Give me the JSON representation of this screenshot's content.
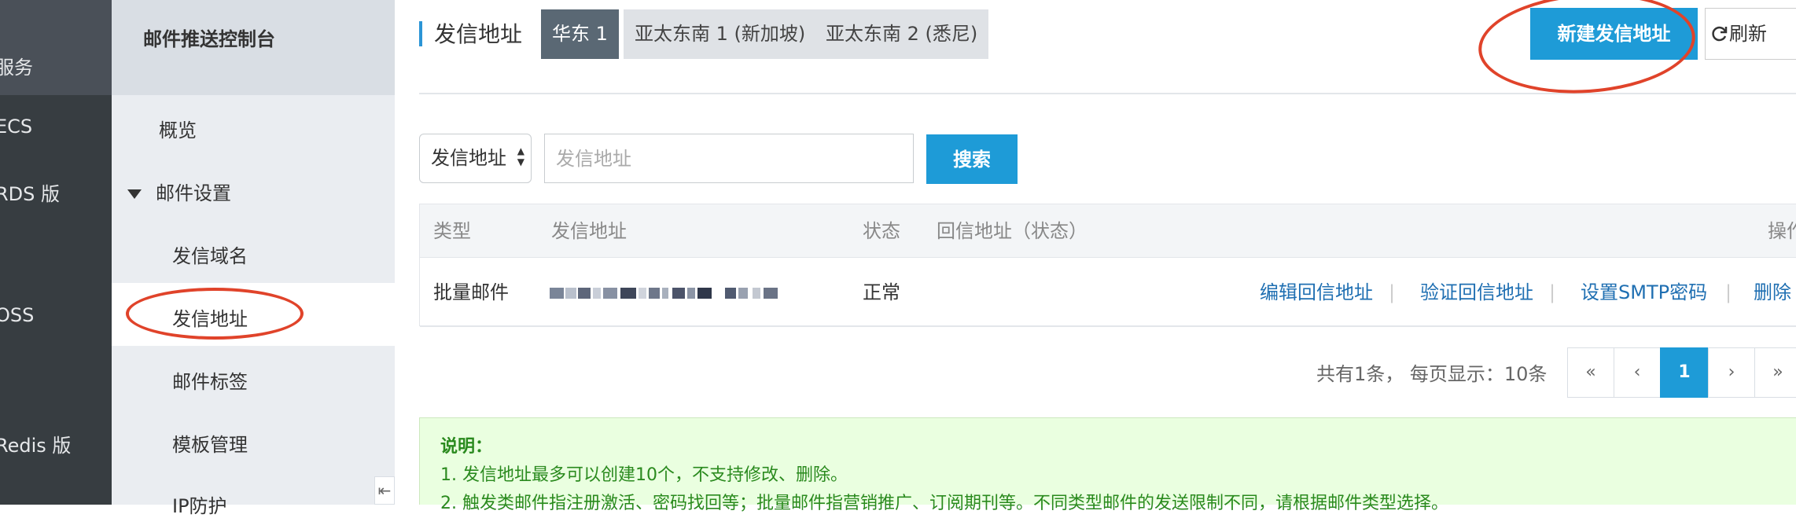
{
  "nav": {
    "items": [
      "服务",
      "ECS",
      "RDS 版",
      "OSS",
      "Redis 版"
    ]
  },
  "sidebar": {
    "title": "邮件推送控制台",
    "overview": "概览",
    "group": "邮件设置",
    "items": [
      "发信域名",
      "发信地址",
      "邮件标签",
      "模板管理",
      "IP防护"
    ],
    "collapse_icon": "⇤"
  },
  "header": {
    "title": "发信地址",
    "regions": [
      "华东 1",
      "亚太东南 1 (新加坡)",
      "亚太东南 2 (悉尼)"
    ],
    "active_region": "华东 1",
    "new_button": "新建发信地址",
    "refresh_button": "刷新"
  },
  "search": {
    "field_select": "发信地址",
    "placeholder": "发信地址",
    "button": "搜索"
  },
  "table": {
    "columns": [
      "类型",
      "发信地址",
      "状态",
      "回信地址（状态）",
      "操作"
    ],
    "rows": [
      {
        "type": "批量邮件",
        "address": "",
        "status": "正常",
        "reply": "",
        "actions": [
          "编辑回信地址",
          "验证回信地址",
          "设置SMTP密码",
          "删除"
        ]
      }
    ]
  },
  "pagination": {
    "summary": "共有1条， 每页显示：10条",
    "first": "«",
    "prev": "‹",
    "current": "1",
    "next": "›",
    "last": "»"
  },
  "note": {
    "heading": "说明：",
    "lines": [
      "1. 发信地址最多可以创建10个，不支持修改、删除。",
      "2. 触发类邮件指注册激活、密码找回等；批量邮件指营销推广、订阅期刊等。不同类型邮件的发送限制不同，请根据邮件类型选择。"
    ]
  },
  "colors": {
    "primary": "#1e9bd7",
    "annotation": "#e0432a",
    "note_bg": "#eaffe0",
    "note_text": "#2a8a1e"
  }
}
